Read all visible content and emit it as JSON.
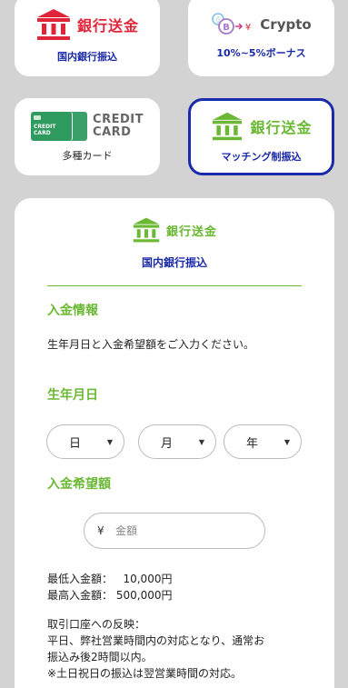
{
  "methods": [
    {
      "logo_text": "銀行送金",
      "caption": "国内銀行振込"
    },
    {
      "logo_text": "Crypto",
      "caption": "10%~5%ボーナス"
    },
    {
      "logo_line1": "CREDIT",
      "logo_line2": "CARD",
      "card_text_1": "CREDIT",
      "card_text_2": "CARD",
      "caption": "多種カード"
    },
    {
      "logo_text": "銀行送金",
      "caption": "マッチング制振込"
    }
  ],
  "panel": {
    "logo_text": "銀行送金",
    "subtitle": "国内銀行振込",
    "deposit_info_title": "入金情報",
    "instruction": "生年月日と入金希望額をご入力ください。",
    "dob_title": "生年月日",
    "day_value": "日",
    "month_value": "月",
    "year_value": "年",
    "amount_title": "入金希望額",
    "currency_symbol": "¥",
    "amount_placeholder": "金額",
    "min_label": "最低入金額：",
    "min_value": "10,000円",
    "max_label": "最高入金額：",
    "max_value": "500,000円",
    "reflect_line1": "取引口座への反映：",
    "reflect_line2": "平日、弊社営業時間内の対応となり、通常お",
    "reflect_line3": "振込み後2時間以内。",
    "reflect_line4": "※土日祝日の振込は翌営業時間の対応。"
  },
  "colors": {
    "accent_blue": "#1a2aa8",
    "bank_red": "#e0253a",
    "bank_green": "#6ab833",
    "background": "#d3d3d3"
  },
  "icons": [
    "bank-icon",
    "crypto-coins-icon",
    "credit-card-icon",
    "chevron-down-icon"
  ]
}
